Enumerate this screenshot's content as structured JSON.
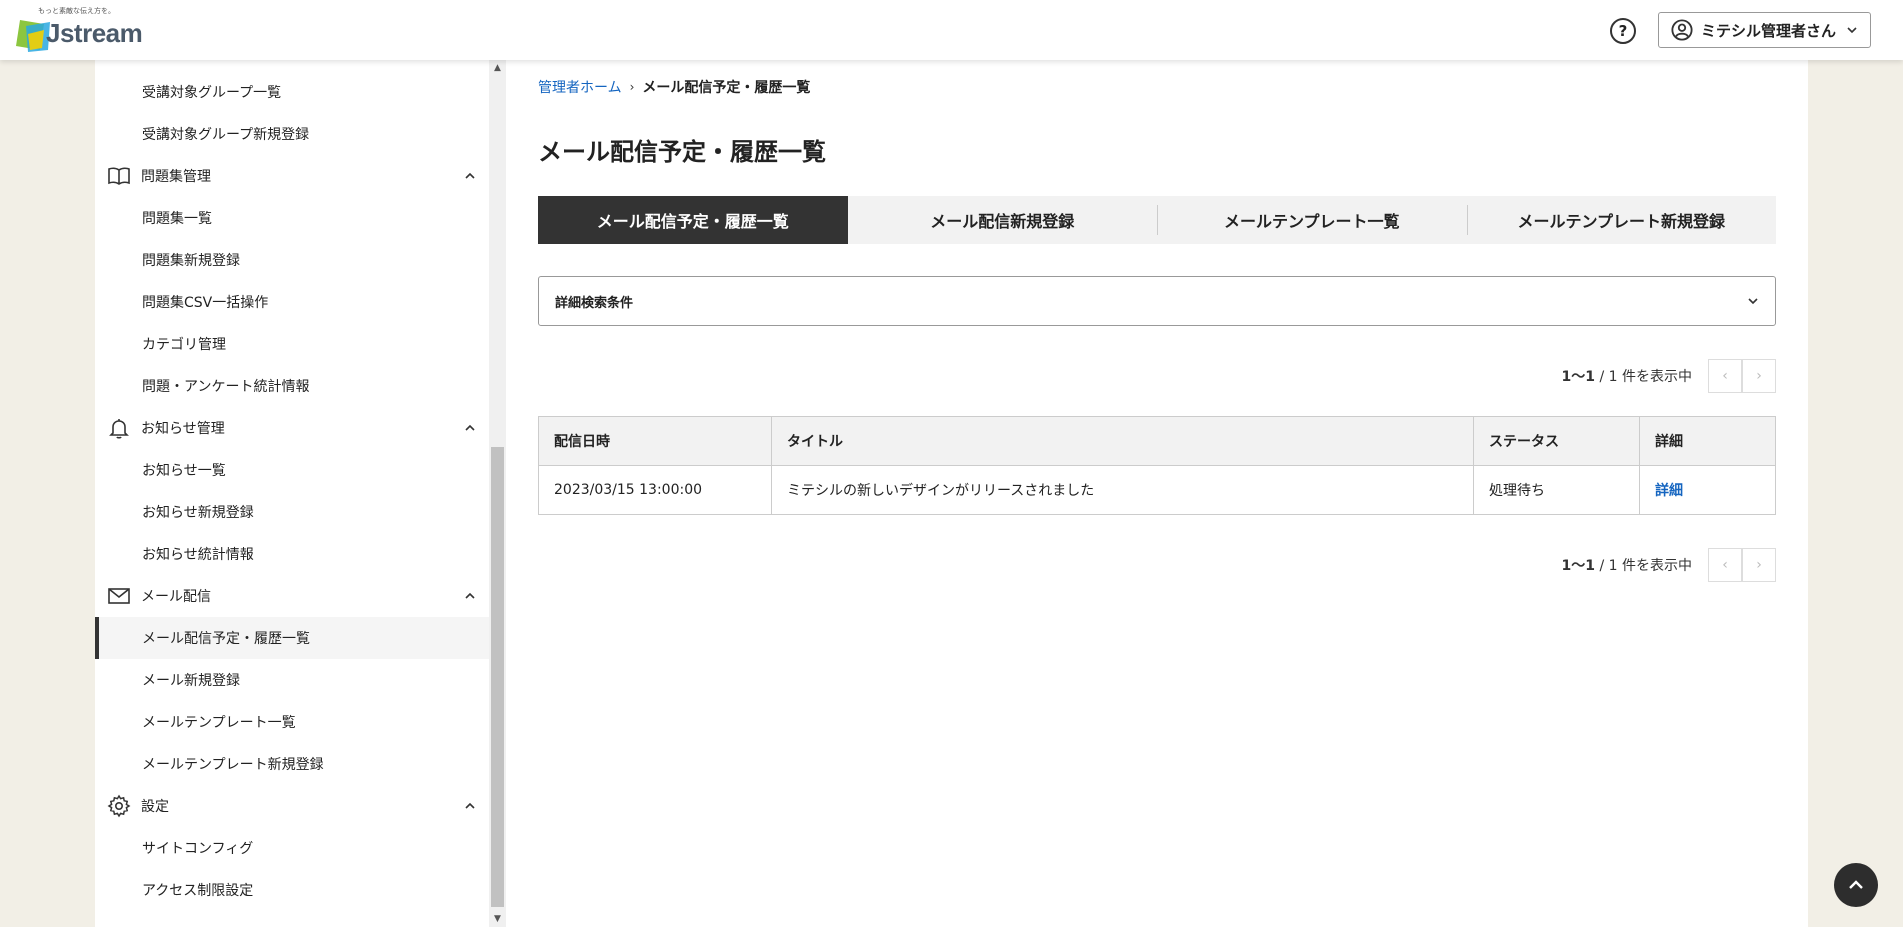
{
  "header": {
    "logo_tagline": "もっと素敵な伝え方を。",
    "logo_text": "Jstream",
    "help_label": "?",
    "user_name": "ミテシル管理者さん"
  },
  "sidebar": {
    "items": [
      {
        "type": "sub",
        "label": "受講対象グループ一覧"
      },
      {
        "type": "sub",
        "label": "受講対象グループ新規登録"
      },
      {
        "type": "group",
        "label": "問題集管理",
        "icon": "book-icon"
      },
      {
        "type": "sub",
        "label": "問題集一覧"
      },
      {
        "type": "sub",
        "label": "問題集新規登録"
      },
      {
        "type": "sub",
        "label": "問題集CSV一括操作"
      },
      {
        "type": "sub",
        "label": "カテゴリ管理"
      },
      {
        "type": "sub",
        "label": "問題・アンケート統計情報"
      },
      {
        "type": "group",
        "label": "お知らせ管理",
        "icon": "bell-icon"
      },
      {
        "type": "sub",
        "label": "お知らせ一覧"
      },
      {
        "type": "sub",
        "label": "お知らせ新規登録"
      },
      {
        "type": "sub",
        "label": "お知らせ統計情報"
      },
      {
        "type": "group",
        "label": "メール配信",
        "icon": "mail-icon"
      },
      {
        "type": "sub",
        "label": "メール配信予定・履歴一覧",
        "active": true
      },
      {
        "type": "sub",
        "label": "メール新規登録"
      },
      {
        "type": "sub",
        "label": "メールテンプレート一覧"
      },
      {
        "type": "sub",
        "label": "メールテンプレート新規登録"
      },
      {
        "type": "group",
        "label": "設定",
        "icon": "gear-icon"
      },
      {
        "type": "sub",
        "label": "サイトコンフィグ"
      },
      {
        "type": "sub",
        "label": "アクセス制限設定"
      }
    ]
  },
  "breadcrumb": {
    "home": "管理者ホーム",
    "current": "メール配信予定・履歴一覧"
  },
  "page_title": "メール配信予定・履歴一覧",
  "tabs": [
    {
      "label": "メール配信予定・履歴一覧",
      "active": true
    },
    {
      "label": "メール配信新規登録"
    },
    {
      "label": "メールテンプレート一覧"
    },
    {
      "label": "メールテンプレート新規登録"
    }
  ],
  "search": {
    "label": "詳細検索条件"
  },
  "pagination": {
    "range": "1〜1",
    "suffix": " / 1 件を表示中",
    "prev": "‹",
    "next": "›"
  },
  "table": {
    "headers": [
      "配信日時",
      "タイトル",
      "ステータス",
      "詳細"
    ],
    "rows": [
      {
        "date": "2023/03/15 13:00:00",
        "title": "ミテシルの新しいデザインがリリースされました",
        "status": "処理待ち",
        "detail": "詳細"
      }
    ]
  },
  "colors": {
    "accent": "#333333",
    "link": "#1565c0",
    "background": "#f2efe6"
  }
}
